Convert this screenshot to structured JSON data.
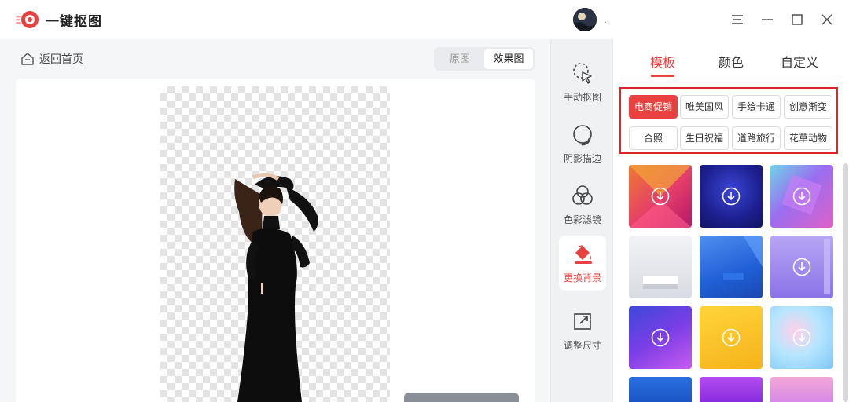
{
  "app": {
    "title": "一键抠图",
    "username": "."
  },
  "canvas": {
    "back_label": "返回首页",
    "view_tabs": {
      "original": "原图",
      "result": "效果图"
    }
  },
  "tools": [
    {
      "label": "手动抠图",
      "icon": "cursor-lasso-icon"
    },
    {
      "label": "阴影描边",
      "icon": "shadow-stroke-icon"
    },
    {
      "label": "色彩滤镜",
      "icon": "color-filter-icon"
    },
    {
      "label": "更换背景",
      "icon": "paint-bucket-icon",
      "active": true
    },
    {
      "label": "调整尺寸",
      "icon": "resize-icon"
    }
  ],
  "panel": {
    "tabs": [
      "模板",
      "颜色",
      "自定义"
    ],
    "active_tab": "模板",
    "categories": [
      "电商促销",
      "唯美国风",
      "手绘卡通",
      "创意渐变",
      "合照",
      "生日祝福",
      "道路旅行",
      "花草动物"
    ],
    "active_category": "电商促销"
  },
  "colors": {
    "accent": "#e8413f",
    "highlight_border": "#d9262b"
  }
}
